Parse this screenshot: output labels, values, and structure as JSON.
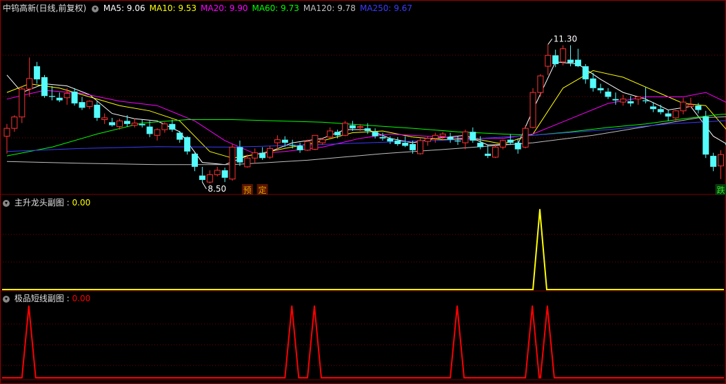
{
  "main_header": {
    "title": "中钨高新(日线,前复权)",
    "ma": [
      {
        "label": "MA5: ",
        "value": "9.06",
        "color": "#ffffff"
      },
      {
        "label": "MA10: ",
        "value": "9.53",
        "color": "#ffff00"
      },
      {
        "label": "MA20: ",
        "value": "9.90",
        "color": "#ff00ff"
      },
      {
        "label": "MA60: ",
        "value": "9.73",
        "color": "#00ff00"
      },
      {
        "label": "MA120: ",
        "value": "9.78",
        "color": "#c0c0c0"
      },
      {
        "label": "MA250: ",
        "value": "9.67",
        "color": "#3b3bff"
      }
    ]
  },
  "sub1_header": {
    "title": "主升龙头副图",
    "sep": " : ",
    "value": "0.00",
    "color": "#ffff00"
  },
  "sub2_header": {
    "title": "极品短线副图",
    "sep": " : ",
    "value": "0.00",
    "color": "#ff0000"
  },
  "colors": {
    "up": "#ff3232",
    "down": "#54fcfc",
    "grid": "#800000",
    "panel_border": "#a00000"
  },
  "chart_data": [
    {
      "type": "candlestick",
      "title": "中钨高新(日线,前复权)",
      "ylim": [
        7.9,
        12.0
      ],
      "candles": [
        [
          9.2,
          9.48,
          8.8,
          9.38
        ],
        [
          9.38,
          9.68,
          9.3,
          9.64
        ],
        [
          9.64,
          10.35,
          9.5,
          10.28
        ],
        [
          10.28,
          11.0,
          10.1,
          10.52
        ],
        [
          10.8,
          10.9,
          10.4,
          10.5
        ],
        [
          10.55,
          10.6,
          10.08,
          10.12
        ],
        [
          10.12,
          10.35,
          10.02,
          10.1
        ],
        [
          10.08,
          10.2,
          9.98,
          10.02
        ],
        [
          10.08,
          10.3,
          9.92,
          10.18
        ],
        [
          10.22,
          10.3,
          9.9,
          9.95
        ],
        [
          9.98,
          10.1,
          9.8,
          9.85
        ],
        [
          9.88,
          10.02,
          9.82,
          10.0
        ],
        [
          9.92,
          10.0,
          9.55,
          9.62
        ],
        [
          9.58,
          9.72,
          9.48,
          9.62
        ],
        [
          9.52,
          9.62,
          9.42,
          9.45
        ],
        [
          9.42,
          9.6,
          9.35,
          9.55
        ],
        [
          9.55,
          9.68,
          9.42,
          9.48
        ],
        [
          9.45,
          9.6,
          9.4,
          9.5
        ],
        [
          9.48,
          9.58,
          9.4,
          9.45
        ],
        [
          9.42,
          9.55,
          9.18,
          9.25
        ],
        [
          9.22,
          9.38,
          9.1,
          9.35
        ],
        [
          9.35,
          9.52,
          9.28,
          9.48
        ],
        [
          9.48,
          9.58,
          9.3,
          9.35
        ],
        [
          9.28,
          9.32,
          9.05,
          9.12
        ],
        [
          9.18,
          9.2,
          8.78,
          8.85
        ],
        [
          8.8,
          8.82,
          8.4,
          8.5
        ],
        [
          8.3,
          8.5,
          8.15,
          8.2
        ],
        [
          8.15,
          8.42,
          8.12,
          8.32
        ],
        [
          8.32,
          8.5,
          8.28,
          8.42
        ],
        [
          8.42,
          8.48,
          8.15,
          8.25
        ],
        [
          8.22,
          9.02,
          8.18,
          8.95
        ],
        [
          8.95,
          9.1,
          8.52,
          8.6
        ],
        [
          8.5,
          8.78,
          8.48,
          8.7
        ],
        [
          8.7,
          8.92,
          8.58,
          8.82
        ],
        [
          8.82,
          8.95,
          8.66,
          8.7
        ],
        [
          8.72,
          8.98,
          8.68,
          8.92
        ],
        [
          9.05,
          9.22,
          8.9,
          9.12
        ],
        [
          9.12,
          9.2,
          8.95,
          9.05
        ],
        [
          9.0,
          9.12,
          8.92,
          8.98
        ],
        [
          8.98,
          9.05,
          8.82,
          8.88
        ],
        [
          8.88,
          9.12,
          8.86,
          9.08
        ],
        [
          8.9,
          9.22,
          8.88,
          9.22
        ],
        [
          9.05,
          9.15,
          9.0,
          9.12
        ],
        [
          9.18,
          9.4,
          9.15,
          9.32
        ],
        [
          9.3,
          9.35,
          9.15,
          9.22
        ],
        [
          9.22,
          9.55,
          9.2,
          9.5
        ],
        [
          9.45,
          9.55,
          9.32,
          9.38
        ],
        [
          9.4,
          9.48,
          9.32,
          9.42
        ],
        [
          9.38,
          9.5,
          9.25,
          9.32
        ],
        [
          9.3,
          9.38,
          9.15,
          9.2
        ],
        [
          9.18,
          9.28,
          9.1,
          9.15
        ],
        [
          9.15,
          9.2,
          9.02,
          9.08
        ],
        [
          9.1,
          9.18,
          8.98,
          9.02
        ],
        [
          9.05,
          9.2,
          8.95,
          8.98
        ],
        [
          9.02,
          9.1,
          8.8,
          8.88
        ],
        [
          8.8,
          9.15,
          8.78,
          9.1
        ],
        [
          9.08,
          9.2,
          8.98,
          9.15
        ],
        [
          9.15,
          9.28,
          9.05,
          9.22
        ],
        [
          9.2,
          9.3,
          9.1,
          9.25
        ],
        [
          9.18,
          9.28,
          9.05,
          9.12
        ],
        [
          9.1,
          9.2,
          9.0,
          9.08
        ],
        [
          9.05,
          9.35,
          8.9,
          9.3
        ],
        [
          9.3,
          9.4,
          9.05,
          9.1
        ],
        [
          9.05,
          9.2,
          8.9,
          8.95
        ],
        [
          8.8,
          9.0,
          8.7,
          8.75
        ],
        [
          8.72,
          9.0,
          8.7,
          8.95
        ],
        [
          8.95,
          9.12,
          8.9,
          9.1
        ],
        [
          9.12,
          9.25,
          9.0,
          9.05
        ],
        [
          9.05,
          9.15,
          8.8,
          8.9
        ],
        [
          8.95,
          9.45,
          8.92,
          9.38
        ],
        [
          9.4,
          10.3,
          9.38,
          10.2
        ],
        [
          10.2,
          10.62,
          10.1,
          10.58
        ],
        [
          10.8,
          11.3,
          10.6,
          11.05
        ],
        [
          11.05,
          11.18,
          10.78,
          10.85
        ],
        [
          10.9,
          11.28,
          10.82,
          11.2
        ],
        [
          10.95,
          11.28,
          10.8,
          10.88
        ],
        [
          10.95,
          11.2,
          10.78,
          10.8
        ],
        [
          10.8,
          10.85,
          10.4,
          10.5
        ],
        [
          10.52,
          10.65,
          10.22,
          10.3
        ],
        [
          10.3,
          10.4,
          10.18,
          10.25
        ],
        [
          10.22,
          10.3,
          10.05,
          10.1
        ],
        [
          10.05,
          10.2,
          9.92,
          10.02
        ],
        [
          9.98,
          10.15,
          9.9,
          10.05
        ],
        [
          10.0,
          10.12,
          9.88,
          9.95
        ],
        [
          10.05,
          10.12,
          9.92,
          10.1
        ],
        [
          10.02,
          10.32,
          9.95,
          10.0
        ],
        [
          9.88,
          9.98,
          9.75,
          9.82
        ],
        [
          9.82,
          9.92,
          9.7,
          9.75
        ],
        [
          9.72,
          9.8,
          9.55,
          9.65
        ],
        [
          9.62,
          9.8,
          9.55,
          9.78
        ],
        [
          9.78,
          10.08,
          9.7,
          9.98
        ],
        [
          9.88,
          10.08,
          9.88,
          9.92
        ],
        [
          9.9,
          9.96,
          9.72,
          9.8
        ],
        [
          9.65,
          9.78,
          8.7,
          8.78
        ],
        [
          8.75,
          8.82,
          8.4,
          8.5
        ],
        [
          8.52,
          8.88,
          8.22,
          8.78
        ],
        [
          9.05,
          9.25,
          8.95,
          9.0
        ],
        [
          9.02,
          9.15,
          8.9,
          8.98
        ],
        [
          8.98,
          9.1,
          8.95,
          9.05
        ]
      ],
      "moving_averages": [
        {
          "name": "MA5",
          "color": "#ffffff",
          "values": [
            [
              0,
              10.6
            ],
            [
              2,
              10.2
            ],
            [
              5,
              10.4
            ],
            [
              8,
              10.35
            ],
            [
              11,
              10.15
            ],
            [
              14,
              9.72
            ],
            [
              17,
              9.6
            ],
            [
              20,
              9.55
            ],
            [
              23,
              9.3
            ],
            [
              26,
              8.6
            ],
            [
              29,
              8.55
            ],
            [
              32,
              8.75
            ],
            [
              35,
              8.85
            ],
            [
              38,
              9.05
            ],
            [
              42,
              9.15
            ],
            [
              45,
              9.35
            ],
            [
              48,
              9.35
            ],
            [
              51,
              9.15
            ],
            [
              54,
              9.05
            ],
            [
              57,
              9.15
            ],
            [
              61,
              9.22
            ],
            [
              64,
              9.0
            ],
            [
              68,
              9.02
            ],
            [
              70,
              9.8
            ],
            [
              73,
              10.9
            ],
            [
              76,
              10.85
            ],
            [
              79,
              10.5
            ],
            [
              82,
              10.2
            ],
            [
              85,
              10.05
            ],
            [
              88,
              9.8
            ],
            [
              91,
              9.88
            ],
            [
              94,
              9.2
            ],
            [
              97,
              8.9
            ],
            [
              98,
              8.95
            ]
          ]
        },
        {
          "name": "MA10",
          "color": "#ffff00",
          "values": [
            [
              0,
              10.2
            ],
            [
              3,
              10.4
            ],
            [
              7,
              10.3
            ],
            [
              11,
              10.1
            ],
            [
              15,
              9.9
            ],
            [
              19,
              9.78
            ],
            [
              23,
              9.55
            ],
            [
              27,
              8.85
            ],
            [
              30,
              8.7
            ],
            [
              33,
              8.78
            ],
            [
              37,
              8.92
            ],
            [
              41,
              9.05
            ],
            [
              46,
              9.28
            ],
            [
              50,
              9.32
            ],
            [
              54,
              9.18
            ],
            [
              58,
              9.12
            ],
            [
              62,
              9.15
            ],
            [
              66,
              9.02
            ],
            [
              70,
              9.25
            ],
            [
              74,
              10.3
            ],
            [
              78,
              10.7
            ],
            [
              82,
              10.55
            ],
            [
              86,
              10.25
            ],
            [
              90,
              9.95
            ],
            [
              93,
              9.9
            ],
            [
              96,
              9.3
            ],
            [
              98,
              9.1
            ]
          ]
        },
        {
          "name": "MA20",
          "color": "#ff00ff",
          "values": [
            [
              0,
              10.05
            ],
            [
              5,
              10.25
            ],
            [
              10,
              10.18
            ],
            [
              15,
              10.0
            ],
            [
              20,
              9.9
            ],
            [
              25,
              9.55
            ],
            [
              29,
              9.1
            ],
            [
              33,
              8.8
            ],
            [
              37,
              8.85
            ],
            [
              42,
              8.95
            ],
            [
              47,
              9.15
            ],
            [
              51,
              9.25
            ],
            [
              56,
              9.2
            ],
            [
              61,
              9.15
            ],
            [
              66,
              9.15
            ],
            [
              70,
              9.25
            ],
            [
              75,
              9.6
            ],
            [
              80,
              9.95
            ],
            [
              85,
              10.1
            ],
            [
              90,
              10.1
            ],
            [
              93,
              10.2
            ],
            [
              96,
              9.95
            ],
            [
              98,
              9.75
            ]
          ]
        },
        {
          "name": "MA60",
          "color": "#00ff00",
          "values": [
            [
              0,
              8.75
            ],
            [
              6,
              8.95
            ],
            [
              12,
              9.25
            ],
            [
              18,
              9.5
            ],
            [
              24,
              9.58
            ],
            [
              30,
              9.58
            ],
            [
              36,
              9.55
            ],
            [
              42,
              9.52
            ],
            [
              48,
              9.45
            ],
            [
              54,
              9.38
            ],
            [
              60,
              9.3
            ],
            [
              66,
              9.25
            ],
            [
              70,
              9.22
            ],
            [
              75,
              9.3
            ],
            [
              80,
              9.4
            ],
            [
              85,
              9.48
            ],
            [
              90,
              9.6
            ],
            [
              95,
              9.7
            ],
            [
              98,
              9.72
            ]
          ]
        },
        {
          "name": "MA120",
          "color": "#c0c0c0",
          "values": [
            [
              0,
              8.62
            ],
            [
              10,
              8.58
            ],
            [
              20,
              8.55
            ],
            [
              30,
              8.55
            ],
            [
              40,
              8.65
            ],
            [
              50,
              8.8
            ],
            [
              60,
              8.92
            ],
            [
              70,
              9.05
            ],
            [
              78,
              9.22
            ],
            [
              85,
              9.42
            ],
            [
              92,
              9.62
            ],
            [
              98,
              9.66
            ]
          ]
        },
        {
          "name": "MA250",
          "color": "#3b3bff",
          "values": [
            [
              0,
              8.85
            ],
            [
              10,
              8.92
            ],
            [
              20,
              8.96
            ],
            [
              30,
              8.95
            ],
            [
              40,
              9.0
            ],
            [
              50,
              9.06
            ],
            [
              60,
              9.12
            ],
            [
              70,
              9.22
            ],
            [
              80,
              9.35
            ],
            [
              88,
              9.48
            ],
            [
              98,
              9.58
            ]
          ]
        }
      ],
      "annotations": [
        {
          "label": "11.30",
          "index": 72,
          "price": 11.3
        },
        {
          "label": "8.50",
          "index": 26,
          "price": 8.15
        }
      ],
      "signals": [
        {
          "label": "预",
          "index": 32,
          "color": "#e0a000"
        },
        {
          "label": "定",
          "index": 34,
          "color": "#e0a000"
        },
        {
          "label": "跌",
          "index": 95,
          "color": "#30e030"
        }
      ]
    },
    {
      "type": "line",
      "title": "主升龙头副图",
      "color": "#ffff00",
      "ylim": [
        0,
        1
      ],
      "spikes": [
        {
          "index": 70,
          "value": 1
        }
      ]
    },
    {
      "type": "line",
      "title": "极品短线副图",
      "color": "#ff0000",
      "ylim": [
        0,
        1
      ],
      "spikes": [
        {
          "index": 2,
          "value": 1
        },
        {
          "index": 37,
          "value": 1
        },
        {
          "index": 40,
          "value": 1
        },
        {
          "index": 59,
          "value": 1
        },
        {
          "index": 69,
          "value": 1
        },
        {
          "index": 71,
          "value": 1
        }
      ]
    }
  ]
}
